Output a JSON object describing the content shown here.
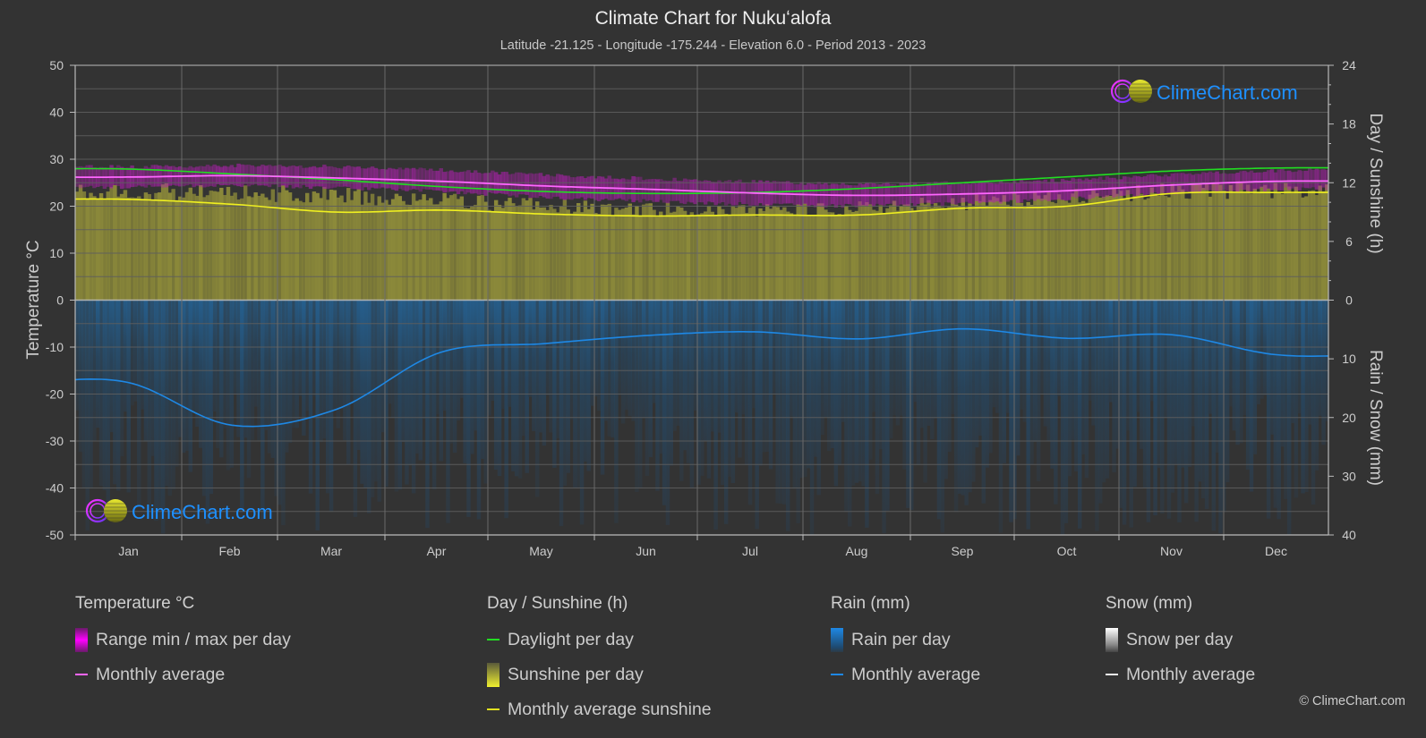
{
  "title": "Climate Chart for Nukuʻalofa",
  "subtitle": "Latitude -21.125 - Longitude -175.244 - Elevation 6.0 - Period 2013 - 2023",
  "logo_text": "ClimeChart.com",
  "copyright": "© ClimeChart.com",
  "colors": {
    "background": "#333333",
    "temp_avg": "#ff66ff",
    "temp_range": "#cc00cc",
    "daylight": "#22dd22",
    "sunshine_fill": "#8c8a3a",
    "sunshine_avg": "#f0f020",
    "rain_fill": "#2a5f8a",
    "rain_avg": "#1e88e5",
    "logo_text": "#1e90ff"
  },
  "legend": {
    "temperature": {
      "title": "Temperature °C",
      "items": [
        "Range min / max per day",
        "Monthly average"
      ]
    },
    "sunshine": {
      "title": "Day / Sunshine (h)",
      "items": [
        "Daylight per day",
        "Sunshine per day",
        "Monthly average sunshine"
      ]
    },
    "rain": {
      "title": "Rain (mm)",
      "items": [
        "Rain per day",
        "Monthly average"
      ]
    },
    "snow": {
      "title": "Snow (mm)",
      "items": [
        "Snow per day",
        "Monthly average"
      ]
    }
  },
  "chart_data": {
    "type": "line",
    "title": "Climate Chart for Nukuʻalofa",
    "categories": [
      "Jan",
      "Feb",
      "Mar",
      "Apr",
      "May",
      "Jun",
      "Jul",
      "Aug",
      "Sep",
      "Oct",
      "Nov",
      "Dec"
    ],
    "axes": {
      "left": {
        "label": "Temperature °C",
        "range": [
          -50,
          50
        ],
        "ticks": [
          "50",
          "40",
          "30",
          "20",
          "10",
          "0",
          "-10",
          "-20",
          "-30",
          "-40",
          "-50"
        ]
      },
      "right_top": {
        "label": "Day / Sunshine (h)",
        "range": [
          0,
          24
        ],
        "ticks": [
          "24",
          "18",
          "12",
          "6",
          "0"
        ]
      },
      "right_bottom": {
        "label": "Rain / Snow (mm)",
        "range": [
          0,
          40
        ],
        "ticks": [
          "0",
          "10",
          "20",
          "30",
          "40"
        ]
      }
    },
    "grid": true,
    "series": [
      {
        "name": "Temperature monthly average",
        "unit": "°C",
        "axis": "left",
        "values": [
          26.2,
          26.5,
          26.0,
          25.3,
          24.3,
          23.6,
          22.8,
          22.3,
          22.6,
          23.3,
          24.5,
          25.3
        ]
      },
      {
        "name": "Temperature range min",
        "unit": "°C",
        "axis": "left",
        "values": [
          24.5,
          24.8,
          24.3,
          23.5,
          22.3,
          21.5,
          20.8,
          20.5,
          21.0,
          22.0,
          23.2,
          24.0
        ]
      },
      {
        "name": "Temperature range max",
        "unit": "°C",
        "axis": "left",
        "values": [
          28.0,
          28.3,
          28.0,
          27.3,
          26.3,
          25.5,
          24.8,
          24.3,
          24.6,
          25.2,
          26.3,
          27.2
        ]
      },
      {
        "name": "Daylight per day",
        "unit": "h",
        "axis": "right_top",
        "values": [
          13.4,
          12.9,
          12.3,
          11.6,
          11.1,
          10.9,
          11.0,
          11.4,
          12.0,
          12.6,
          13.2,
          13.5
        ]
      },
      {
        "name": "Monthly average sunshine",
        "unit": "h",
        "axis": "right_top",
        "values": [
          10.3,
          9.8,
          9.0,
          9.2,
          8.8,
          8.6,
          8.7,
          8.7,
          9.4,
          9.6,
          10.9,
          11.0
        ]
      },
      {
        "name": "Sunshine per day",
        "unit": "h",
        "axis": "right_top",
        "values": [
          12.0,
          11.9,
          11.6,
          11.0,
          10.4,
          10.0,
          10.0,
          10.2,
          10.8,
          11.3,
          12.0,
          12.2
        ]
      },
      {
        "name": "Rain monthly average",
        "unit": "mm",
        "axis": "right_bottom",
        "values": [
          14.0,
          21.3,
          18.6,
          8.9,
          7.4,
          6.0,
          5.4,
          6.6,
          4.9,
          6.5,
          5.9,
          9.3
        ]
      },
      {
        "name": "Snow monthly average",
        "unit": "mm",
        "axis": "right_bottom",
        "values": [
          0,
          0,
          0,
          0,
          0,
          0,
          0,
          0,
          0,
          0,
          0,
          0
        ]
      }
    ]
  }
}
